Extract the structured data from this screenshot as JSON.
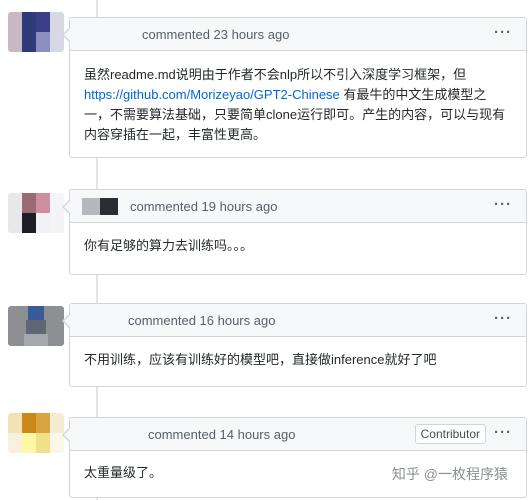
{
  "comments": [
    {
      "time": "commented 23 hours ago",
      "body_before": "虽然readme.md说明由于作者不会nlp所以不引入深度学习框架，但",
      "link": "https://github.com/Morizeyao/GPT2-Chinese",
      "body_after": " 有最牛的中文生成模型之一，不需要算法基础，只要简单clone运行即可。产生的内容，可以与现有内容穿插在一起，丰富性更高。",
      "menu": "···"
    },
    {
      "time": "commented 19 hours ago",
      "body": "你有足够的算力去训练吗。。。",
      "menu": "···"
    },
    {
      "time": "commented 16 hours ago",
      "body": "不用训练，应该有训练好的模型吧，直接做inference就好了吧",
      "menu": "···"
    },
    {
      "time": "commented 14 hours ago",
      "badge": "Contributor",
      "body": "太重量级了。",
      "menu": "···"
    }
  ],
  "watermark": "知乎 @一枚程序猿",
  "colors": {
    "link": "#0366d6",
    "header_bg": "#f6f8fa",
    "border": "#d1d5da"
  }
}
